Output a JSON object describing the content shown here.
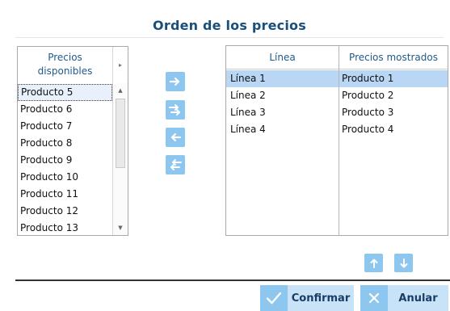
{
  "title": "Orden de los precios",
  "left_list": {
    "header": [
      "Precios",
      "disponibles"
    ],
    "items": [
      "Producto 5",
      "Producto 6",
      "Producto 7",
      "Producto 8",
      "Producto 9",
      "Producto 10",
      "Producto 11",
      "Producto 12",
      "Producto 13"
    ],
    "selected_index": 0
  },
  "grid": {
    "columns": [
      "Línea",
      "Precios mostrados"
    ],
    "rows": [
      [
        "Línea 1",
        "Producto 1"
      ],
      [
        "Línea 2",
        "Producto 2"
      ],
      [
        "Línea 3",
        "Producto 3"
      ],
      [
        "Línea 4",
        "Producto 4"
      ]
    ],
    "selected_row": 0
  },
  "buttons": {
    "confirm": "Confirmar",
    "cancel": "Anular"
  },
  "icons": {
    "add": "arrow-right-icon",
    "add_all": "double-arrow-right-icon",
    "remove": "arrow-left-icon",
    "remove_all": "double-arrow-left-icon",
    "up": "arrow-up-icon",
    "down": "arrow-down-icon",
    "confirm": "check-icon",
    "cancel": "x-icon"
  },
  "colors": {
    "accent": "#8dc6ee",
    "button_bg": "#c8e3f7",
    "title": "#1a4e7b",
    "selected_row": "#b9d6f5"
  }
}
